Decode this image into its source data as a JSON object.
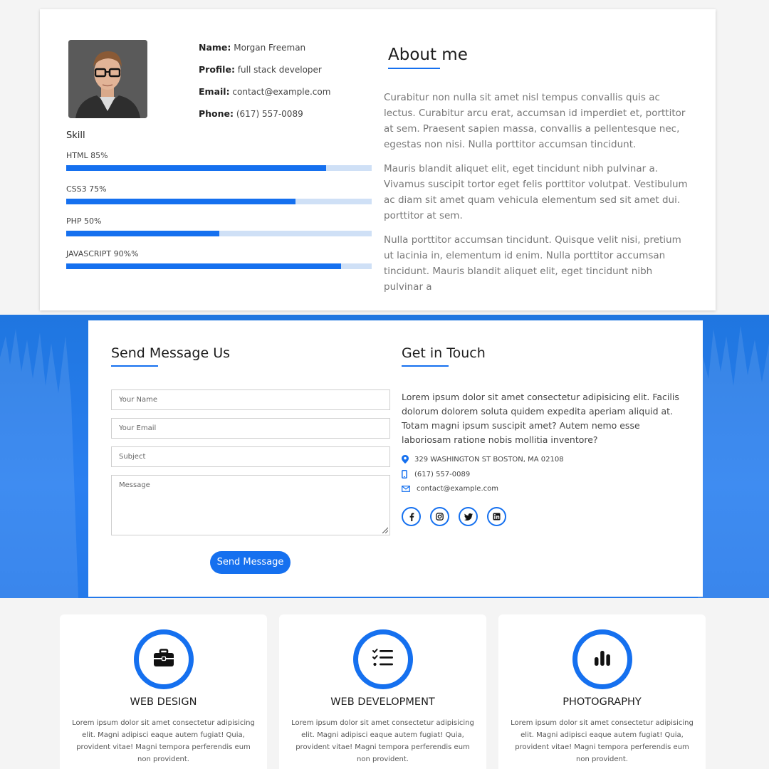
{
  "profile": {
    "name_label": "Name:",
    "name_value": "Morgan Freeman",
    "profile_label": "Profile:",
    "profile_value": "full stack developer",
    "email_label": "Email:",
    "email_value": "contact@example.com",
    "phone_label": "Phone:",
    "phone_value": "(617) 557-0089",
    "skill_title": "Skill",
    "skills": [
      {
        "label": "HTML 85%",
        "level": 0.85
      },
      {
        "label": "CSS3 75%",
        "level": 0.75
      },
      {
        "label": "PHP 50%",
        "level": 0.5
      },
      {
        "label": "JAVASCRIPT 90%%",
        "level": 0.9
      }
    ]
  },
  "about": {
    "title": "About me",
    "paragraphs": [
      "Curabitur non nulla sit amet nisl tempus convallis quis ac lectus. Curabitur arcu erat, accumsan id imperdiet et, porttitor at sem. Praesent sapien massa, convallis a pellentesque nec, egestas non nisi. Nulla porttitor accumsan tincidunt.",
      "Mauris blandit aliquet elit, eget tincidunt nibh pulvinar a. Vivamus suscipit tortor eget felis porttitor volutpat. Vestibulum ac diam sit amet quam vehicula elementum sed sit amet dui. porttitor at sem.",
      "Nulla porttitor accumsan tincidunt. Quisque velit nisi, pretium ut lacinia in, elementum id enim. Nulla porttitor accumsan tincidunt. Mauris blandit aliquet elit, eget tincidunt nibh pulvinar a"
    ]
  },
  "contact_form": {
    "title": "Send Message Us",
    "name_placeholder": "Your Name",
    "email_placeholder": "Your Email",
    "subject_placeholder": "Subject",
    "message_placeholder": "Message",
    "send_label": "Send Message"
  },
  "get_in_touch": {
    "title": "Get in Touch",
    "text": "Lorem ipsum dolor sit amet consectetur adipisicing elit. Facilis dolorum dolorem soluta quidem expedita aperiam aliquid at. Totam magni ipsum suscipit amet? Autem nemo esse laboriosam ratione nobis mollitia inventore?",
    "address": "329 WASHINGTON ST BOSTON, MA 02108",
    "phone": "(617) 557-0089",
    "email": "contact@example.com",
    "social_icons": [
      "facebook-icon",
      "instagram-icon",
      "twitter-icon",
      "linkedin-icon"
    ]
  },
  "services": [
    {
      "icon": "briefcase-icon",
      "title": "WEB DESIGN",
      "text": "Lorem ipsum dolor sit amet consectetur adipisicing elit. Magni adipisci eaque autem fugiat! Quia, provident vitae! Magni tempora perferendis eum non provident."
    },
    {
      "icon": "checklist-icon",
      "title": "WEB DEVELOPMENT",
      "text": "Lorem ipsum dolor sit amet consectetur adipisicing elit. Magni adipisci eaque autem fugiat! Quia, provident vitae! Magni tempora perferendis eum non provident."
    },
    {
      "icon": "bar-chart-icon",
      "title": "PHOTOGRAPHY",
      "text": "Lorem ipsum dolor sit amet consectetur adipisicing elit. Magni adipisci eaque autem fugiat! Quia, provident vitae! Magni tempora perferendis eum non provident."
    }
  ],
  "colors": {
    "accent": "#1570ef",
    "track": "#cfe0f6",
    "band": "#2379ea"
  }
}
